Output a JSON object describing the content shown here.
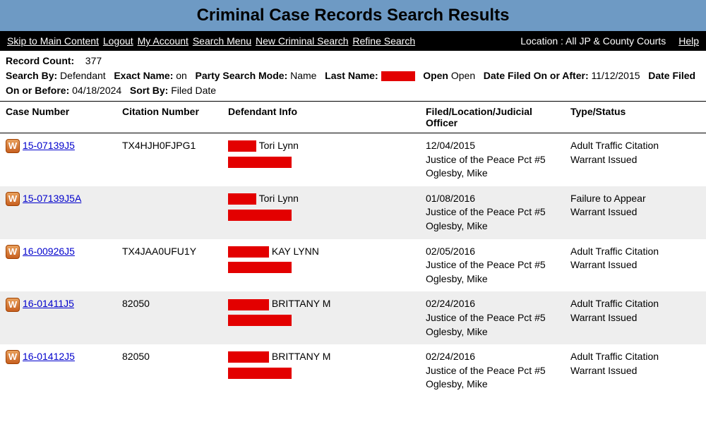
{
  "header": {
    "title": "Criminal Case Records Search Results"
  },
  "nav": {
    "skip": "Skip to Main Content",
    "logout": "Logout",
    "my_account": "My Account",
    "search_menu": "Search Menu",
    "new_search": "New Criminal Search",
    "refine": "Refine Search",
    "location_label": "Location : All JP & County Courts",
    "help": "Help"
  },
  "meta": {
    "record_count_label": "Record Count:",
    "record_count": "377",
    "search_by_label": "Search By:",
    "search_by": "Defendant",
    "exact_name_label": "Exact Name:",
    "exact_name": "on",
    "party_mode_label": "Party Search Mode:",
    "party_mode": "Name",
    "last_name_label": "Last Name:",
    "open_label": "Open",
    "open_value": "Open",
    "filed_after_label": "Date Filed On or After:",
    "filed_after": "11/12/2015",
    "filed_before_label": "Date Filed On or Before:",
    "filed_before": "04/18/2024",
    "sort_by_label": "Sort By:",
    "sort_by": "Filed Date"
  },
  "columns": {
    "case": "Case Number",
    "citation": "Citation Number",
    "defendant": "Defendant Info",
    "filed": "Filed/Location/Judicial Officer",
    "type": "Type/Status"
  },
  "rows": [
    {
      "case_number": "15-07139J5",
      "citation": "TX4HJH0FJPG1",
      "defendant_visible": "Tori Lynn",
      "filed_date": "12/04/2015",
      "location": "Justice of the Peace Pct #5",
      "officer": "Oglesby, Mike",
      "type": "Adult Traffic Citation",
      "status": "Warrant Issued"
    },
    {
      "case_number": "15-07139J5A",
      "citation": "",
      "defendant_visible": "Tori Lynn",
      "filed_date": "01/08/2016",
      "location": "Justice of the Peace Pct #5",
      "officer": "Oglesby, Mike",
      "type": "Failure to Appear",
      "status": "Warrant Issued"
    },
    {
      "case_number": "16-00926J5",
      "citation": "TX4JAA0UFU1Y",
      "defendant_visible": "KAY LYNN",
      "filed_date": "02/05/2016",
      "location": "Justice of the Peace Pct #5",
      "officer": "Oglesby, Mike",
      "type": "Adult Traffic Citation",
      "status": "Warrant Issued"
    },
    {
      "case_number": "16-01411J5",
      "citation": "82050",
      "defendant_visible": "BRITTANY M",
      "filed_date": "02/24/2016",
      "location": "Justice of the Peace Pct #5",
      "officer": "Oglesby, Mike",
      "type": "Adult Traffic Citation",
      "status": "Warrant Issued"
    },
    {
      "case_number": "16-01412J5",
      "citation": "82050",
      "defendant_visible": "BRITTANY M",
      "filed_date": "02/24/2016",
      "location": "Justice of the Peace Pct #5",
      "officer": "Oglesby, Mike",
      "type": "Adult Traffic Citation",
      "status": "Warrant Issued"
    }
  ],
  "warrant_glyph": "W"
}
